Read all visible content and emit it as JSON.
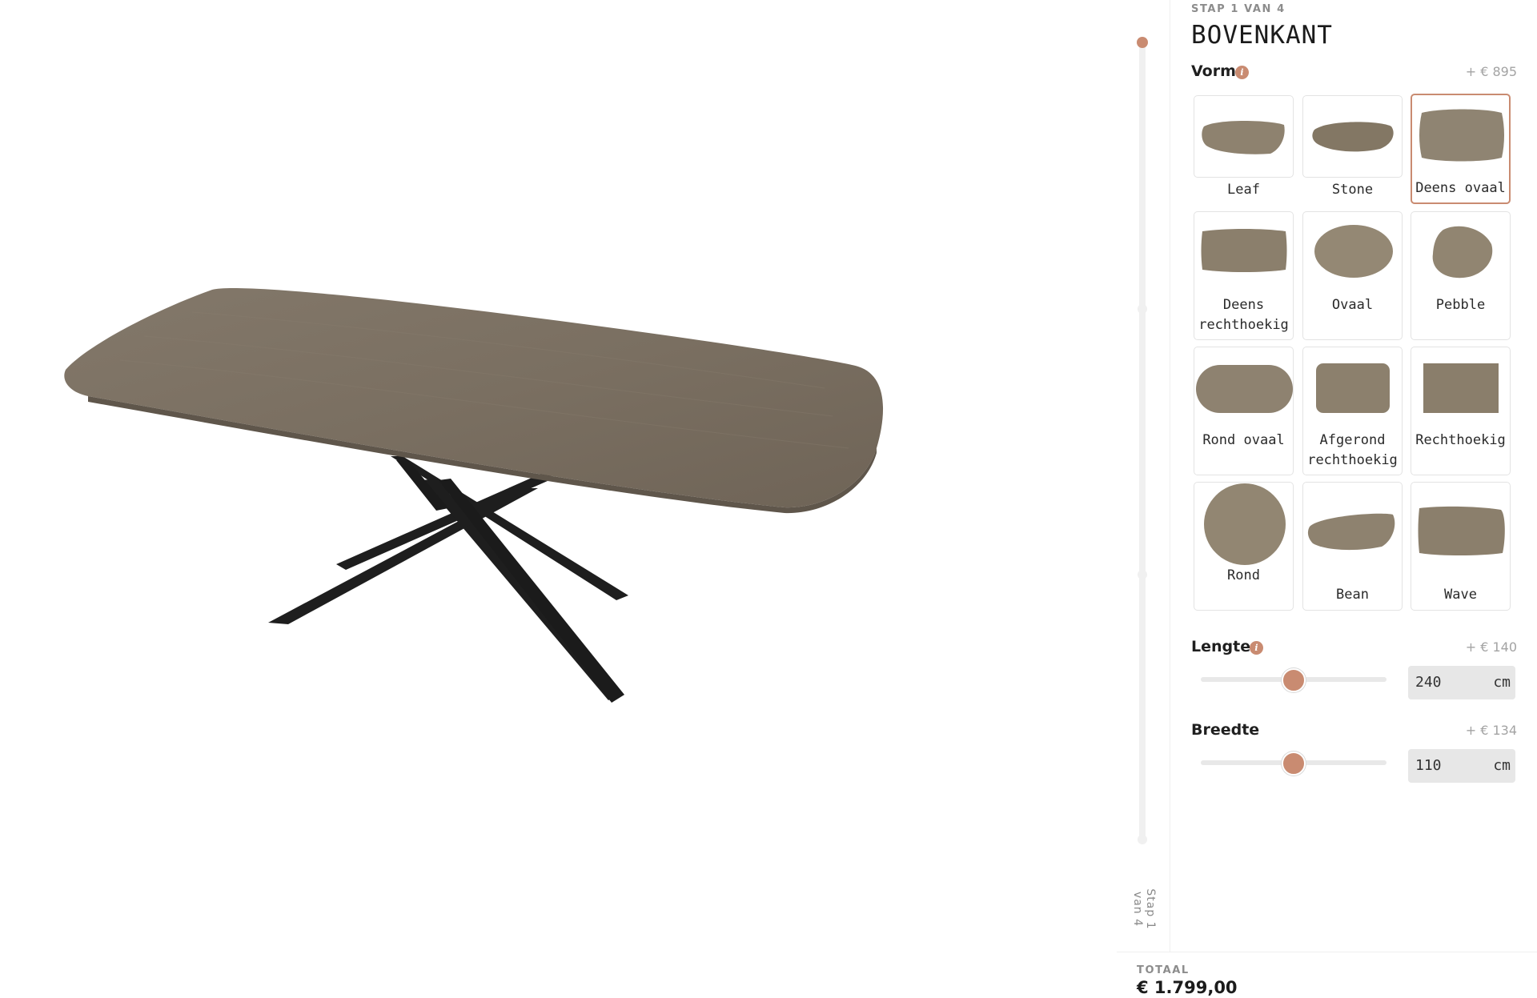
{
  "step": {
    "label": "STAP 1 VAN 4",
    "title": "BOVENKANT",
    "vertical_label": "Stap 1 van 4"
  },
  "vorm": {
    "title": "Vorm",
    "price": "+ € 895",
    "options": [
      {
        "label": "Leaf",
        "selected": false
      },
      {
        "label": "Stone",
        "selected": false
      },
      {
        "label": "Deens ovaal",
        "selected": true
      },
      {
        "label": "Deens rechthoekig",
        "selected": false
      },
      {
        "label": "Ovaal",
        "selected": false
      },
      {
        "label": "Pebble",
        "selected": false
      },
      {
        "label": "Rond ovaal",
        "selected": false
      },
      {
        "label": "Afgerond rechthoekig",
        "selected": false
      },
      {
        "label": "Rechthoekig",
        "selected": false
      },
      {
        "label": "Rond",
        "selected": false
      },
      {
        "label": "Bean",
        "selected": false
      },
      {
        "label": "Wave",
        "selected": false
      }
    ]
  },
  "lengte": {
    "title": "Lengte",
    "price": "+ € 140",
    "value": "240",
    "unit": "cm",
    "slider_fraction": 0.5
  },
  "breedte": {
    "title": "Breedte",
    "price": "+ € 134",
    "value": "110",
    "unit": "cm",
    "slider_fraction": 0.5
  },
  "total": {
    "label": "TOTAAL",
    "value": "€ 1.799,00"
  },
  "colors": {
    "accent": "#c98b71",
    "wood": "#7c7162",
    "leg": "#1f1f1f"
  },
  "icons": {
    "info": "info-icon"
  }
}
